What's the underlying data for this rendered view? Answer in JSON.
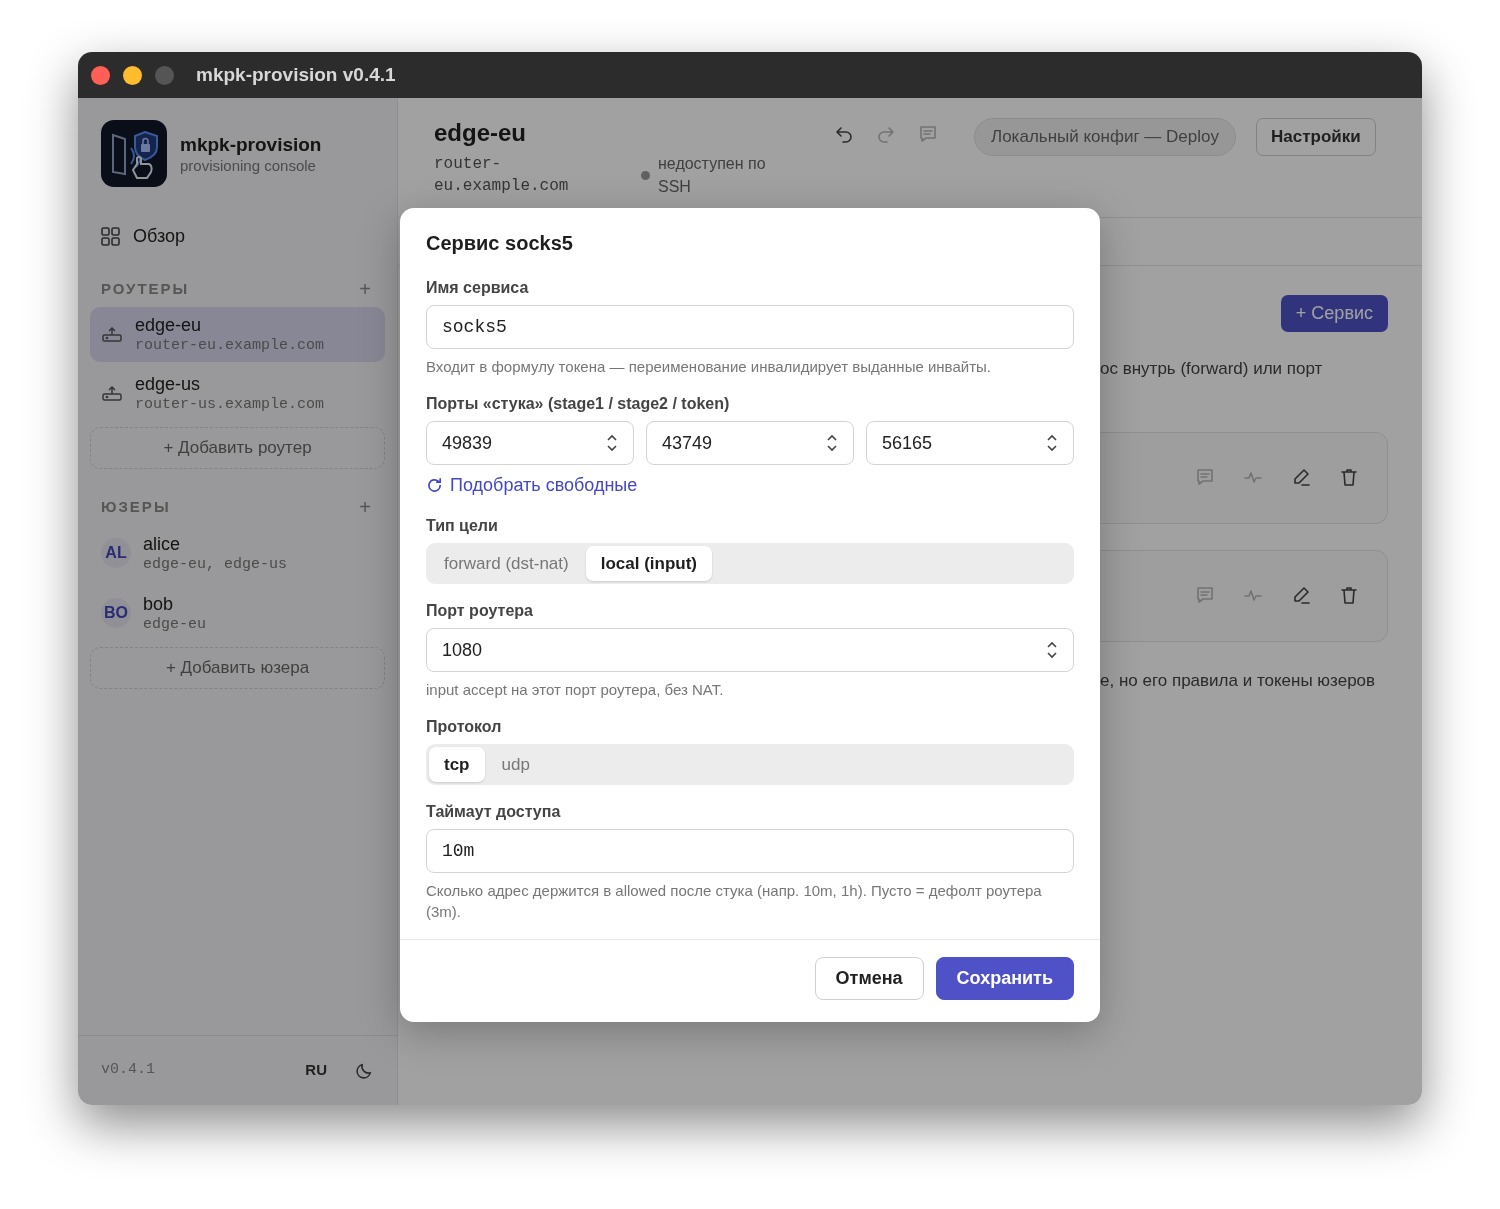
{
  "window": {
    "title": "mkpk-provision v0.4.1"
  },
  "sidebar": {
    "app_name": "mkpk-provision",
    "app_subtitle": "provisioning console",
    "overview": "Обзор",
    "routers": {
      "heading": "РОУТЕРЫ",
      "add_icon": "+",
      "items": [
        {
          "name": "edge-eu",
          "host": "router-eu.example.com",
          "selected": true
        },
        {
          "name": "edge-us",
          "host": "router-us.example.com",
          "selected": false
        }
      ],
      "add_button": "+ Добавить роутер"
    },
    "users": {
      "heading": "ЮЗЕРЫ",
      "add_icon": "+",
      "items": [
        {
          "initials": "AL",
          "name": "alice",
          "routers": "edge-eu, edge-us"
        },
        {
          "initials": "BO",
          "name": "bob",
          "routers": "edge-eu"
        }
      ],
      "add_button": "+ Добавить юзера"
    },
    "footer": {
      "version": "v0.4.1",
      "language": "RU"
    }
  },
  "header": {
    "title": "edge-eu",
    "host": "router-eu.example.com",
    "status": {
      "text": "недоступен по SSH",
      "online": false
    },
    "toolbar": [
      {
        "kind": "undo",
        "disabled": false
      },
      {
        "kind": "redo",
        "disabled": true
      },
      {
        "kind": "comment",
        "disabled": true
      }
    ],
    "deploy_button": "Локальный конфиг — Deploy",
    "settings_button": "Настройки"
  },
  "content": {
    "add_service_button": "+ Сервис",
    "intro_fragment": "ос внутрь (forward) или порт",
    "cards": [
      {
        "actions": [
          {
            "kind": "comment",
            "disabled": true
          },
          {
            "kind": "pulse",
            "disabled": true
          },
          {
            "kind": "edit",
            "disabled": false
          },
          {
            "kind": "delete",
            "disabled": false
          }
        ]
      },
      {
        "actions": [
          {
            "kind": "comment",
            "disabled": true
          },
          {
            "kind": "pulse",
            "disabled": true
          },
          {
            "kind": "edit",
            "disabled": false
          },
          {
            "kind": "delete",
            "disabled": false
          }
        ]
      }
    ],
    "note_fragment": "е, но его правила и токены юзеров"
  },
  "dialog": {
    "title": "Сервис socks5",
    "fields": [
      {
        "kind": "text",
        "label": "Имя сервиса",
        "value": "socks5",
        "hint": "Входит в формулу токена — переименование инвалидирует выданные инвайты."
      },
      {
        "kind": "ports",
        "label": "Порты «стука» (stage1 / stage2 / token)",
        "values": [
          "49839",
          "43749",
          "56165"
        ],
        "action": "Подобрать свободные"
      },
      {
        "kind": "segmented",
        "label": "Тип цели",
        "options": [
          {
            "label": "forward (dst-nat)",
            "selected": false
          },
          {
            "label": "local (input)",
            "selected": true
          }
        ]
      },
      {
        "kind": "number",
        "label": "Порт роутера",
        "value": "1080",
        "hint": "input accept на этот порт роутера, без NAT."
      },
      {
        "kind": "segmented",
        "label": "Протокол",
        "options": [
          {
            "label": "tcp",
            "selected": true
          },
          {
            "label": "udp",
            "selected": false
          }
        ]
      },
      {
        "kind": "text",
        "label": "Таймаут доступа",
        "value": "10m",
        "hint": "Сколько адрес держится в allowed после стука (напр. 10m, 1h). Пусто = дефолт роутера (3m)."
      }
    ],
    "buttons": [
      {
        "label": "Отмена",
        "kind": "secondary"
      },
      {
        "label": "Сохранить",
        "kind": "primary"
      }
    ]
  }
}
